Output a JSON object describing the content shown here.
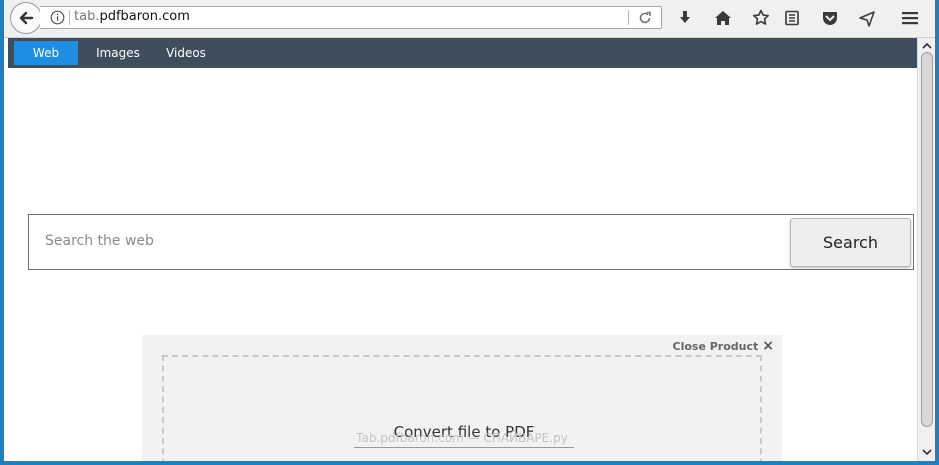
{
  "browser": {
    "url_host_dim": "tab.",
    "url_host": "pdfbaron.com",
    "icons": [
      "arrow-left-icon",
      "info-icon",
      "reload-icon",
      "download-icon",
      "home-icon",
      "star-icon",
      "reading-list-icon",
      "pocket-icon",
      "send-icon",
      "hamburger-menu-icon"
    ]
  },
  "nav": {
    "tabs": [
      {
        "label": "Web",
        "active": true
      },
      {
        "label": "Images",
        "active": false
      },
      {
        "label": "Videos",
        "active": false
      }
    ]
  },
  "search": {
    "placeholder": "Search the web",
    "button_label": "Search"
  },
  "product": {
    "close_label": "Close Product",
    "close_glyph": "×",
    "title": "Convert file to PDF",
    "watermark": "Tab.pdfbaron.com — СПАЙВАРЕ.ру"
  },
  "colors": {
    "nav_bg": "#3e4e5c",
    "nav_active": "#1d8ee2",
    "frame": "#1f7fc0"
  }
}
